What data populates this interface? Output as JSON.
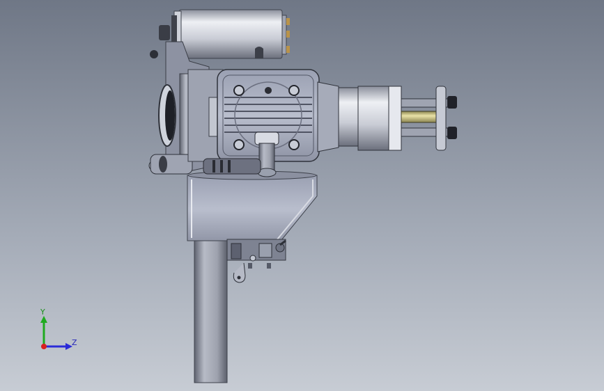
{
  "colors": {
    "viewport_top": "#6f7786",
    "viewport_bottom": "#c7ccd4",
    "metal_light": "#e2e4ea",
    "metal_mid": "#a9adba",
    "metal_dark": "#5a5e6b",
    "axis_y": "#1faa1f",
    "axis_z": "#2b2bd8",
    "axis_x": "#d82020",
    "brass": "#c8c07a"
  },
  "triad": {
    "y_label": "Y",
    "z_label": "Z",
    "x_axis_icon": "x-axis-dot-icon"
  }
}
